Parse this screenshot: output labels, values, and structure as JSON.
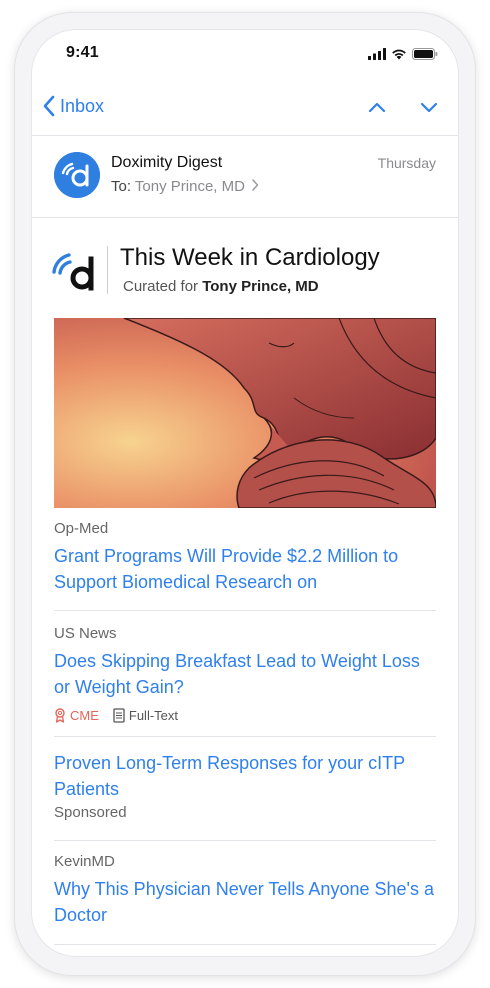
{
  "status_bar": {
    "time": "9:41"
  },
  "nav": {
    "back_label": "Inbox"
  },
  "email": {
    "sender_name": "Doximity Digest",
    "to_label": "To:",
    "to_name": "Tony Prince, MD",
    "date": "Thursday"
  },
  "digest": {
    "title": "This Week in Cardiology",
    "curated_prefix": "Curated for",
    "curated_name": "Tony Prince, MD"
  },
  "articles": [
    {
      "source": "Op-Med",
      "title": "Grant Programs Will Provide $2.2 Million to Support Biomedical Research on"
    },
    {
      "source": "US News",
      "title": "Does Skipping Breakfast Lead to Weight Loss or Weight Gain?",
      "tags": [
        "CME",
        "Full-Text"
      ]
    },
    {
      "title": "Proven Long-Term Responses for your cITP Patients",
      "sponsored_label": "Sponsored"
    },
    {
      "source": "KevinMD",
      "title": "Why This Physician Never Tells Anyone She's a Doctor"
    }
  ],
  "colors": {
    "accent_blue": "#2f80ed",
    "brand_blue": "#2f7fe1",
    "cme_red": "#e2645a",
    "muted_gray": "#8a8a8e"
  }
}
